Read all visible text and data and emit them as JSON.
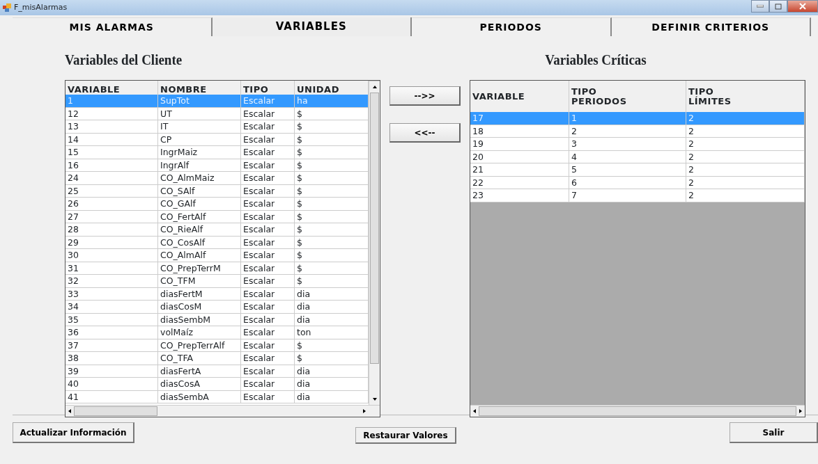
{
  "window": {
    "title": "F_misAlarmas"
  },
  "tabs": [
    {
      "label": "MIS ALARMAS",
      "selected": false
    },
    {
      "label": "VARIABLES",
      "selected": true
    },
    {
      "label": "PERIODOS",
      "selected": false
    },
    {
      "label": "DEFINIR CRITERIOS",
      "selected": false
    }
  ],
  "client_variables": {
    "title": "Variables del Cliente",
    "columns": [
      "VARIABLE",
      "NOMBRE",
      "TIPO",
      "UNIDAD"
    ],
    "rows": [
      {
        "cells": [
          "1",
          "SupTot",
          "Escalar",
          "ha"
        ],
        "selected": true
      },
      {
        "cells": [
          "12",
          "UT",
          "Escalar",
          "$"
        ],
        "selected": false
      },
      {
        "cells": [
          "13",
          "IT",
          "Escalar",
          "$"
        ],
        "selected": false
      },
      {
        "cells": [
          "14",
          "CP",
          "Escalar",
          "$"
        ],
        "selected": false
      },
      {
        "cells": [
          "15",
          "IngrMaiz",
          "Escalar",
          "$"
        ],
        "selected": false
      },
      {
        "cells": [
          "16",
          "IngrAlf",
          "Escalar",
          "$"
        ],
        "selected": false
      },
      {
        "cells": [
          "24",
          "CO_AlmMaiz",
          "Escalar",
          "$"
        ],
        "selected": false
      },
      {
        "cells": [
          "25",
          "CO_SAlf",
          "Escalar",
          "$"
        ],
        "selected": false
      },
      {
        "cells": [
          "26",
          "CO_GAlf",
          "Escalar",
          "$"
        ],
        "selected": false
      },
      {
        "cells": [
          "27",
          "CO_FertAlf",
          "Escalar",
          "$"
        ],
        "selected": false
      },
      {
        "cells": [
          "28",
          "CO_RieAlf",
          "Escalar",
          "$"
        ],
        "selected": false
      },
      {
        "cells": [
          "29",
          "CO_CosAlf",
          "Escalar",
          "$"
        ],
        "selected": false
      },
      {
        "cells": [
          "30",
          "CO_AlmAlf",
          "Escalar",
          "$"
        ],
        "selected": false
      },
      {
        "cells": [
          "31",
          "CO_PrepTerrM",
          "Escalar",
          "$"
        ],
        "selected": false
      },
      {
        "cells": [
          "32",
          "CO_TFM",
          "Escalar",
          "$"
        ],
        "selected": false
      },
      {
        "cells": [
          "33",
          "diasFertM",
          "Escalar",
          "dia"
        ],
        "selected": false
      },
      {
        "cells": [
          "34",
          "diasCosM",
          "Escalar",
          "dia"
        ],
        "selected": false
      },
      {
        "cells": [
          "35",
          "diasSembM",
          "Escalar",
          "dia"
        ],
        "selected": false
      },
      {
        "cells": [
          "36",
          "volMaíz",
          "Escalar",
          "ton"
        ],
        "selected": false
      },
      {
        "cells": [
          "37",
          "CO_PrepTerrAlf",
          "Escalar",
          "$"
        ],
        "selected": false
      },
      {
        "cells": [
          "38",
          "CO_TFA",
          "Escalar",
          "$"
        ],
        "selected": false
      },
      {
        "cells": [
          "39",
          "diasFertA",
          "Escalar",
          "dia"
        ],
        "selected": false
      },
      {
        "cells": [
          "40",
          "diasCosA",
          "Escalar",
          "dia"
        ],
        "selected": false
      },
      {
        "cells": [
          "41",
          "diasSembA",
          "Escalar",
          "dia"
        ],
        "selected": false
      }
    ]
  },
  "move_buttons": [
    "-->>",
    "<<--"
  ],
  "critical_variables": {
    "title": "Variables Críticas",
    "columns": [
      "VARIABLE",
      "TIPO PERIODOS",
      "TIPO LÍMITES"
    ],
    "rows": [
      {
        "cells": [
          "17",
          "1",
          "2"
        ],
        "selected": true
      },
      {
        "cells": [
          "18",
          "2",
          "2"
        ],
        "selected": false
      },
      {
        "cells": [
          "19",
          "3",
          "2"
        ],
        "selected": false
      },
      {
        "cells": [
          "20",
          "4",
          "2"
        ],
        "selected": false
      },
      {
        "cells": [
          "21",
          "5",
          "2"
        ],
        "selected": false
      },
      {
        "cells": [
          "22",
          "6",
          "2"
        ],
        "selected": false
      },
      {
        "cells": [
          "23",
          "7",
          "2"
        ],
        "selected": false
      }
    ]
  },
  "footer_buttons": [
    "Actualizar Información",
    "Restaurar Valores",
    "Salir"
  ]
}
